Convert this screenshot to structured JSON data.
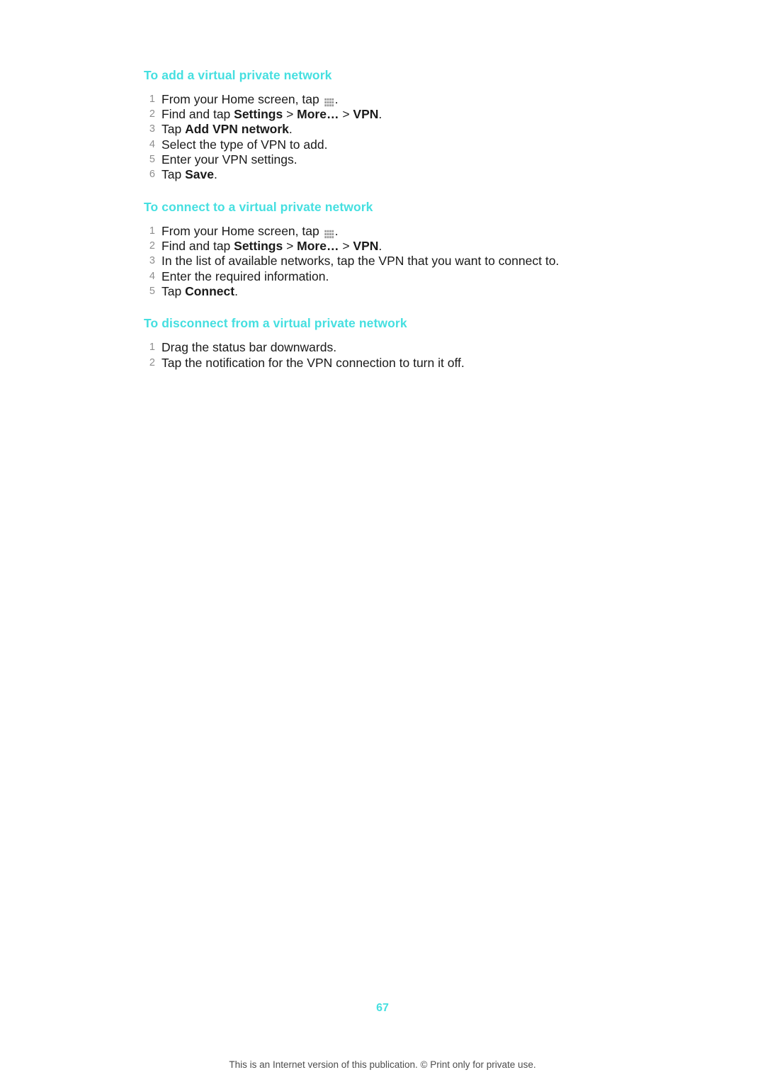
{
  "page": {
    "number": "67",
    "footer": "This is an Internet version of this publication. © Print only for private use."
  },
  "sections": [
    {
      "heading": "To add a virtual private network",
      "steps": [
        {
          "num": "1",
          "parts": [
            {
              "t": "From your Home screen, tap ",
              "b": false
            },
            {
              "icon": "app-grid-icon"
            },
            {
              "t": ".",
              "b": false
            }
          ]
        },
        {
          "num": "2",
          "parts": [
            {
              "t": "Find and tap ",
              "b": false
            },
            {
              "t": "Settings",
              "b": true
            },
            {
              "t": " > ",
              "b": false
            },
            {
              "t": "More…",
              "b": true
            },
            {
              "t": " > ",
              "b": false
            },
            {
              "t": "VPN",
              "b": true
            },
            {
              "t": ".",
              "b": false
            }
          ]
        },
        {
          "num": "3",
          "parts": [
            {
              "t": "Tap ",
              "b": false
            },
            {
              "t": "Add VPN network",
              "b": true
            },
            {
              "t": ".",
              "b": false
            }
          ]
        },
        {
          "num": "4",
          "parts": [
            {
              "t": "Select the type of VPN to add.",
              "b": false
            }
          ]
        },
        {
          "num": "5",
          "parts": [
            {
              "t": "Enter your VPN settings.",
              "b": false
            }
          ]
        },
        {
          "num": "6",
          "parts": [
            {
              "t": "Tap ",
              "b": false
            },
            {
              "t": "Save",
              "b": true
            },
            {
              "t": ".",
              "b": false
            }
          ]
        }
      ]
    },
    {
      "heading": "To connect to a virtual private network",
      "steps": [
        {
          "num": "1",
          "parts": [
            {
              "t": "From your Home screen, tap ",
              "b": false
            },
            {
              "icon": "app-grid-icon"
            },
            {
              "t": ".",
              "b": false
            }
          ]
        },
        {
          "num": "2",
          "parts": [
            {
              "t": "Find and tap ",
              "b": false
            },
            {
              "t": "Settings",
              "b": true
            },
            {
              "t": " > ",
              "b": false
            },
            {
              "t": "More…",
              "b": true
            },
            {
              "t": " > ",
              "b": false
            },
            {
              "t": "VPN",
              "b": true
            },
            {
              "t": ".",
              "b": false
            }
          ]
        },
        {
          "num": "3",
          "parts": [
            {
              "t": "In the list of available networks, tap the VPN that you want to connect to.",
              "b": false
            }
          ]
        },
        {
          "num": "4",
          "parts": [
            {
              "t": "Enter the required information.",
              "b": false
            }
          ]
        },
        {
          "num": "5",
          "parts": [
            {
              "t": "Tap ",
              "b": false
            },
            {
              "t": "Connect",
              "b": true
            },
            {
              "t": ".",
              "b": false
            }
          ]
        }
      ]
    },
    {
      "heading": "To disconnect from a virtual private network",
      "steps": [
        {
          "num": "1",
          "parts": [
            {
              "t": "Drag the status bar downwards.",
              "b": false
            }
          ]
        },
        {
          "num": "2",
          "parts": [
            {
              "t": "Tap the notification for the VPN connection to turn it off.",
              "b": false
            }
          ]
        }
      ]
    }
  ],
  "colors": {
    "heading": "#45dfe0",
    "number": "#8d8d8d",
    "text": "#1a1a1a"
  }
}
